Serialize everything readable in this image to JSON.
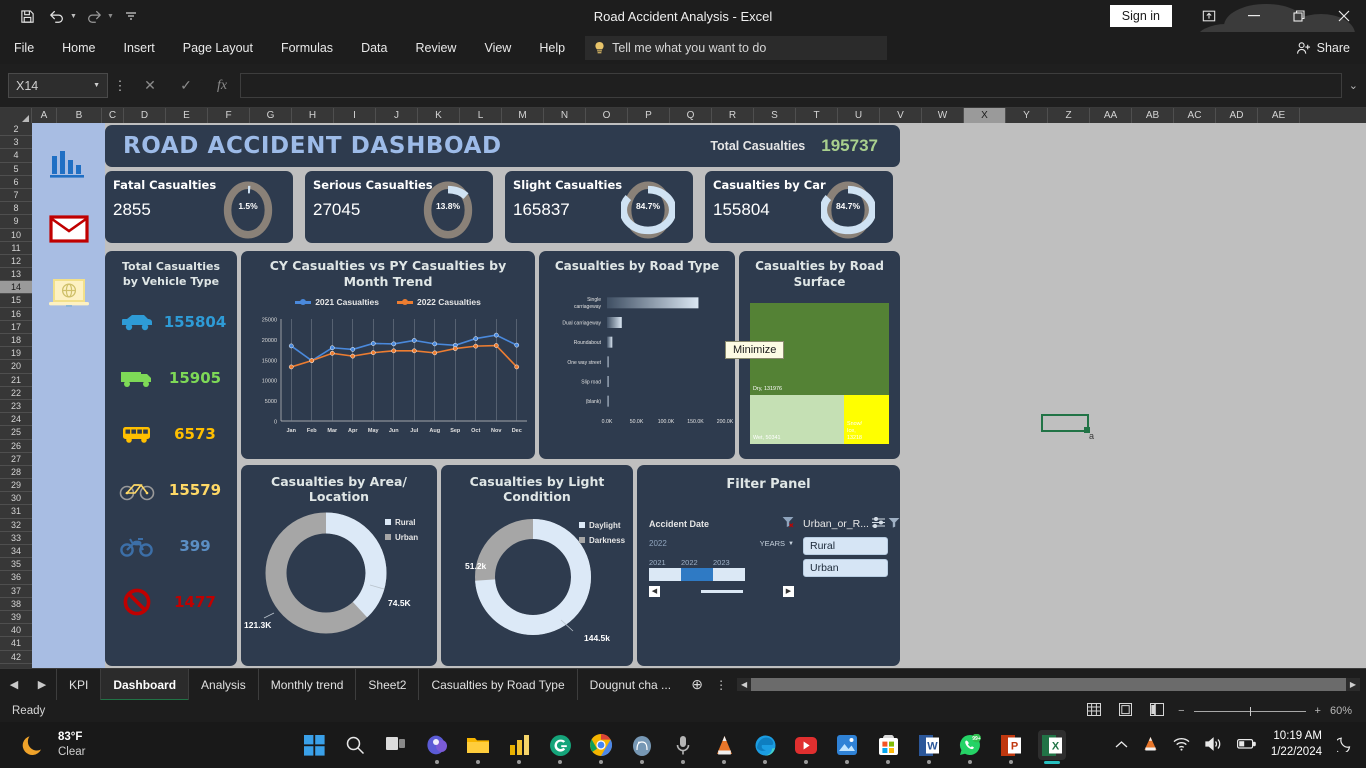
{
  "window": {
    "title": "Road Accident Analysis  -  Excel",
    "signin": "Sign in",
    "share": "Share",
    "minimize_icon": "minimize-icon",
    "restore_icon": "restore-icon",
    "close_icon": "close-icon",
    "ribbon_display_icon": "ribbon-display-options-icon"
  },
  "qat": {
    "save": "save-icon",
    "undo": "undo-icon",
    "redo": "redo-icon",
    "more": "customize-qat-icon"
  },
  "ribbon": {
    "tabs": [
      "File",
      "Home",
      "Insert",
      "Page Layout",
      "Formulas",
      "Data",
      "Review",
      "View",
      "Help"
    ],
    "tellme_placeholder": "Tell me what you want to do"
  },
  "formula_bar": {
    "namebox": "X14",
    "cancel": "cancel-icon",
    "enter": "enter-icon",
    "fx": "fx",
    "value": ""
  },
  "grid": {
    "columns": [
      "A",
      "B",
      "C",
      "D",
      "E",
      "F",
      "G",
      "H",
      "I",
      "J",
      "K",
      "L",
      "M",
      "N",
      "O",
      "P",
      "Q",
      "R",
      "S",
      "T",
      "U",
      "V",
      "W",
      "X",
      "Y",
      "Z",
      "AA",
      "AB",
      "AC",
      "AD",
      "AE"
    ],
    "selected_column": "X",
    "rows": [
      "2",
      "3",
      "4",
      "5",
      "6",
      "7",
      "8",
      "9",
      "10",
      "11",
      "12",
      "13",
      "14",
      "15",
      "16",
      "17",
      "18",
      "19",
      "20",
      "21",
      "22",
      "23",
      "24",
      "25",
      "26",
      "27",
      "28",
      "29",
      "30",
      "31",
      "32",
      "33",
      "34",
      "35",
      "36",
      "37",
      "38",
      "39",
      "40",
      "41",
      "42"
    ],
    "selected_row": "14",
    "cell_text": "a"
  },
  "sidebar_icons": [
    {
      "name": "bar-chart-icon"
    },
    {
      "name": "envelope-icon"
    },
    {
      "name": "laptop-globe-icon"
    }
  ],
  "dashboard": {
    "title": "ROAD ACCIDENT DASHBOAD",
    "total_label": "Total Casualties",
    "total_value": "195737",
    "accent_title": "#9dbbe8",
    "accent_total": "#a9d08e",
    "card_bg": "#2e3b4e",
    "kpis": [
      {
        "label": "Fatal Casualties",
        "value": "2855",
        "pct": "1.5%",
        "fraction": 0.015
      },
      {
        "label": "Serious Casualties",
        "value": "27045",
        "pct": "13.8%",
        "fraction": 0.138
      },
      {
        "label": "Slight Casualties",
        "value": "165837",
        "pct": "84.7%",
        "fraction": 0.847
      },
      {
        "label": "Casualties by Car",
        "value": "155804",
        "pct": "84.7%",
        "fraction": 0.847
      }
    ],
    "vehicle_panel": {
      "title": "Total Casualties by Vehicle Type",
      "rows": [
        {
          "icon": "car-icon",
          "value": "155804",
          "color": "#2e9bd6"
        },
        {
          "icon": "van-icon",
          "value": "15905",
          "color": "#7ed957"
        },
        {
          "icon": "bus-icon",
          "value": "6573",
          "color": "#ffbf00"
        },
        {
          "icon": "bicycle-icon",
          "value": "15579",
          "color": "#ffd966"
        },
        {
          "icon": "motorcycle-icon",
          "value": "399",
          "color": "#5b8ec4"
        },
        {
          "icon": "no-entry-icon",
          "value": "1477",
          "color": "#c00000"
        }
      ]
    },
    "road_surface": {
      "title": "Casualties by Road Surface",
      "tiles": [
        {
          "label": "Dry, 131976",
          "value": 131976,
          "color": "#548235",
          "text": "#ffffff"
        },
        {
          "label": "Wet, 50341",
          "value": 50341,
          "color": "#c5e0b4",
          "text": "#ffffff"
        },
        {
          "label": "Snow/ Ice, 13218",
          "value": 13218,
          "color": "#ffff00",
          "text": "#ffffff"
        }
      ]
    },
    "area_location": {
      "title": "Casualties by Area/ Location",
      "legend": [
        {
          "label": "Rural",
          "color": "#dce9f7"
        },
        {
          "label": "Urban",
          "color": "#a6a6a6"
        }
      ],
      "labels": [
        {
          "text": "74.5K",
          "value": 74500
        },
        {
          "text": "121.3K",
          "value": 121300
        }
      ]
    },
    "light_condition": {
      "title": "Casualties by Light Condition",
      "legend": [
        {
          "label": "Daylight",
          "color": "#dce9f7"
        },
        {
          "label": "Darkness",
          "color": "#a6a6a6"
        }
      ],
      "labels": [
        {
          "text": "144.5k",
          "value": 144500
        },
        {
          "text": "51.2k",
          "value": 51200
        }
      ]
    },
    "filter_panel": {
      "title": "Filter Panel",
      "timeline": {
        "label": "Accident Date",
        "selected": "2022",
        "level": "YEARS",
        "clear_icon": "clear-filter-icon",
        "dropdown_icon": "chevron-down-icon",
        "years": [
          "2021",
          "2022",
          "2023"
        ],
        "selected_year": "2022",
        "prev_icon": "scroll-left-icon",
        "next_icon": "scroll-right-icon"
      },
      "slicer": {
        "label": "Urban_or_R...",
        "multiselect_icon": "multi-select-icon",
        "clear_icon": "clear-filter-icon",
        "items": [
          "Rural",
          "Urban"
        ]
      }
    }
  },
  "tooltip": {
    "text": "Minimize"
  },
  "chart_data": [
    {
      "type": "line",
      "title": "CY Casualties vs PY Casualties by Month Trend",
      "categories": [
        "Jan",
        "Feb",
        "Mar",
        "Apr",
        "May",
        "Jun",
        "Jul",
        "Aug",
        "Sep",
        "Oct",
        "Nov",
        "Dec"
      ],
      "series": [
        {
          "name": "2021 Casualties",
          "color": "#4a89dc",
          "values": [
            18400,
            14800,
            17950,
            17550,
            19000,
            18900,
            19750,
            18900,
            18550,
            20200,
            21050,
            18600
          ]
        },
        {
          "name": "2022 Casualties",
          "color": "#ed7d31",
          "values": [
            13250,
            14800,
            16600,
            15900,
            16750,
            17200,
            17200,
            16700,
            17750,
            18350,
            18500,
            13250
          ]
        }
      ],
      "ylim": [
        0,
        25000
      ],
      "yticks": [
        0,
        5000,
        10000,
        15000,
        20000,
        25000
      ],
      "xlabel": "",
      "ylabel": "",
      "grid": false,
      "legend_position": "top"
    },
    {
      "type": "bar",
      "orientation": "horizontal",
      "title": "Casualties by Road Type",
      "categories": [
        "Single carriageway",
        "Dual carriageway",
        "Roundabout",
        "One way street",
        "Slip road",
        "(blank)"
      ],
      "values": [
        155000,
        25000,
        9000,
        2000,
        1800,
        1200
      ],
      "xticks": [
        "0.0K",
        "50.0K",
        "100.0K",
        "150.0K",
        "200.0K"
      ],
      "xlim": [
        0,
        200000
      ],
      "bar_gradient": [
        "#3f4f63",
        "#dbe7f3"
      ]
    },
    {
      "type": "heatmap",
      "subtype": "treemap",
      "title": "Casualties by Road Surface",
      "categories": [
        "Dry",
        "Wet",
        "Snow/ Ice"
      ],
      "values": [
        131976,
        50341,
        13218
      ],
      "colors": [
        "#548235",
        "#c5e0b4",
        "#ffff00"
      ]
    },
    {
      "type": "pie",
      "subtype": "doughnut",
      "title": "Casualties by Area/ Location",
      "categories": [
        "Rural",
        "Urban"
      ],
      "values": [
        74500,
        121300
      ],
      "colors": [
        "#dce9f7",
        "#a6a6a6"
      ]
    },
    {
      "type": "pie",
      "subtype": "doughnut",
      "title": "Casualties by Light Condition",
      "categories": [
        "Daylight",
        "Darkness"
      ],
      "values": [
        144500,
        51200
      ],
      "colors": [
        "#dce9f7",
        "#a6a6a6"
      ]
    }
  ],
  "sheet_tabs": {
    "prev_icon": "previous-sheet-icon",
    "next_icon": "next-sheet-icon",
    "tabs": [
      "KPI",
      "Dashboard",
      "Analysis",
      "Monthly trend",
      "Sheet2",
      "Casualties by Road Type",
      "Dougnut cha ..."
    ],
    "active": "Dashboard",
    "add_icon": "add-sheet-icon",
    "more_icon": "all-sheets-icon"
  },
  "status_bar": {
    "text": "Ready",
    "views": [
      "normal-view-icon",
      "page-layout-icon",
      "page-break-icon"
    ],
    "zoom_out": "−",
    "zoom_in": "+",
    "zoom": "60%"
  },
  "taskbar": {
    "weather": {
      "temp": "83°F",
      "condition": "Clear",
      "icon": "moon-icon"
    },
    "apps": [
      "start-icon",
      "search-icon",
      "task-view-icon",
      "teams-icon",
      "file-explorer-icon",
      "power-bi-icon",
      "grammarly-icon",
      "chrome-icon",
      "postgresql-icon",
      "mic-icon",
      "vlc-icon",
      "edge-icon",
      "youtube-icon",
      "photos-icon",
      "microsoft-store-icon",
      "word-icon",
      "whatsapp-icon",
      "powerpoint-icon",
      "excel-icon"
    ],
    "tray": {
      "chevron_icon": "show-hidden-icons",
      "vlc_icon": "vlc-tray-icon",
      "wifi_icon": "wifi-icon",
      "volume_icon": "volume-icon",
      "battery_icon": "battery-icon",
      "time": "10:19 AM",
      "date": "1/22/2024",
      "notification_icon": "do-not-disturb-icon"
    }
  }
}
